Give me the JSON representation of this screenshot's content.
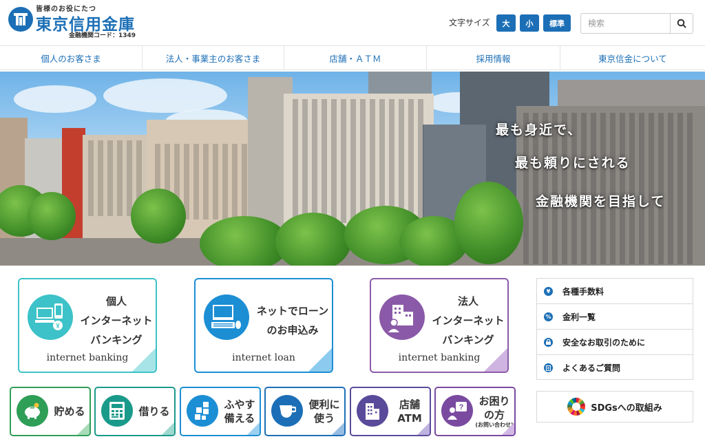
{
  "header": {
    "tagline": "皆様のお役にたつ",
    "bank_name": "東京信用金庫",
    "bank_code": "金融機関コード：1349",
    "fontsize_label": "文字サイズ",
    "fontsize_large": "大",
    "fontsize_small": "小",
    "fontsize_standard": "標準",
    "search_placeholder": "検索"
  },
  "nav": {
    "items": [
      {
        "label": "個人のお客さま"
      },
      {
        "label": "法人・事業主のお客さま"
      },
      {
        "label": "店舗・ＡＴＭ"
      },
      {
        "label": "採用情報"
      },
      {
        "label": "東京信金について"
      }
    ]
  },
  "hero": {
    "lines": [
      "最も身近で、",
      "最も頼りにされる",
      "金融機関を目指して"
    ]
  },
  "cards": [
    {
      "title_lines": [
        "個人",
        "インターネット",
        "バンキング"
      ],
      "subtitle": "internet banking",
      "color": "#3cc2c8"
    },
    {
      "title_lines": [
        "ネットでローン",
        "のお申込み"
      ],
      "subtitle": "internet loan",
      "color": "#1c8ed4"
    },
    {
      "title_lines": [
        "法人",
        "インターネット",
        "バンキング"
      ],
      "subtitle": "internet banking",
      "color": "#8a5aa8"
    }
  ],
  "side_links": [
    {
      "label": "各種手数料",
      "icon": "yen-icon"
    },
    {
      "label": "金利一覧",
      "icon": "percent-icon"
    },
    {
      "label": "安全なお取引のために",
      "icon": "lock-icon"
    },
    {
      "label": "よくあるご質問",
      "icon": "faq-icon"
    }
  ],
  "tiles": [
    {
      "lines": [
        "貯める"
      ],
      "color": "#2f9e57",
      "icon": "piggy-bank-icon"
    },
    {
      "lines": [
        "借りる"
      ],
      "color": "#1a9a8a",
      "icon": "calculator-icon"
    },
    {
      "lines": [
        "ふやす",
        "備える"
      ],
      "color": "#1c8ed4",
      "icon": "growth-icon"
    },
    {
      "lines": [
        "便利に",
        "使う"
      ],
      "color": "#1c6fb6",
      "icon": "cup-icon"
    },
    {
      "lines": [
        "店舗",
        "ATM"
      ],
      "color": "#5a4a9a",
      "icon": "building-icon"
    },
    {
      "lines": [
        "お困り",
        "の方"
      ],
      "note": "(お問い合わせ)",
      "color": "#7a4aa0",
      "icon": "question-icon"
    }
  ],
  "sdgs": {
    "label": "SDGsへの取組み"
  },
  "colors": {
    "brand": "#1c6fb6"
  }
}
